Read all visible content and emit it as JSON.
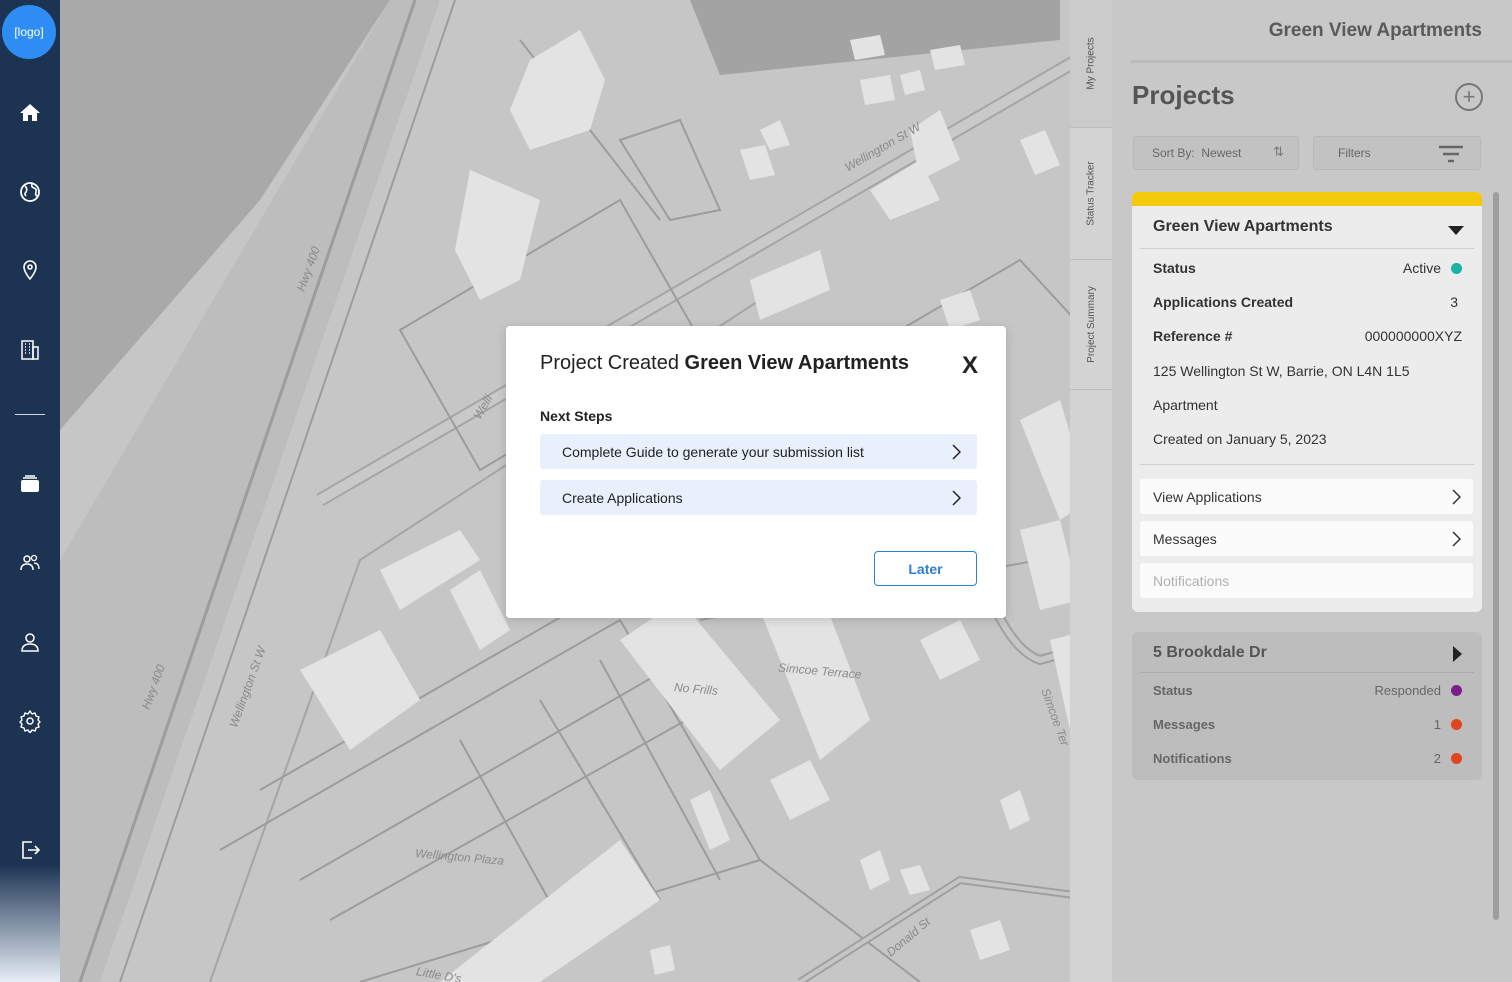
{
  "nav": {
    "logo": "[logo]",
    "items": [
      {
        "name": "home-icon"
      },
      {
        "name": "globe-icon"
      },
      {
        "name": "location-pin-icon"
      },
      {
        "name": "building-icon"
      },
      {
        "name": "folder-stack-icon"
      },
      {
        "name": "users-icon"
      },
      {
        "name": "user-icon"
      },
      {
        "name": "gear-icon"
      },
      {
        "name": "logout-icon"
      }
    ]
  },
  "map": {
    "labels": [
      "Wellington St W",
      "Hwy 400",
      "Hwy 400",
      "Wellington St W",
      "No Frills",
      "Simcoe Terrace",
      "Wellington Plaza",
      "Simcoe Ter",
      "Donald St",
      "Little D's",
      "Welli"
    ]
  },
  "side_tabs": [
    "My Projects",
    "Status Tracker",
    "Project Summary"
  ],
  "panel": {
    "app_title": "Green View Apartments",
    "heading": "Projects",
    "sort_label": "Sort By:",
    "sort_value": "Newest",
    "filters_label": "Filters",
    "project1": {
      "accent_color": "#f3c90c",
      "title": "Green View Apartments",
      "status_label": "Status",
      "status_value": "Active",
      "status_color": "#1ab3a6",
      "apps_label": "Applications Created",
      "apps_value": "3",
      "ref_label": "Reference #",
      "ref_value": "000000000XYZ",
      "address": "125 Wellington St W, Barrie, ON L4N 1L5",
      "type": "Apartment",
      "created": "Created on January 5, 2023",
      "links": [
        "View Applications",
        "Messages",
        "Notifications"
      ]
    },
    "project2": {
      "title": "5 Brookdale Dr",
      "status_label": "Status",
      "status_value": "Responded",
      "status_color": "#7a1f8a",
      "messages_label": "Messages",
      "messages_value": "1",
      "notifications_label": "Notifications",
      "notifications_value": "2",
      "alert_color": "#e0451f"
    }
  },
  "modal": {
    "title_prefix": "Project Created",
    "title_project": "Green View Apartments",
    "close": "X",
    "subtitle": "Next Steps",
    "steps": [
      "Complete Guide to generate your submission list",
      "Create Applications"
    ],
    "later": "Later"
  }
}
